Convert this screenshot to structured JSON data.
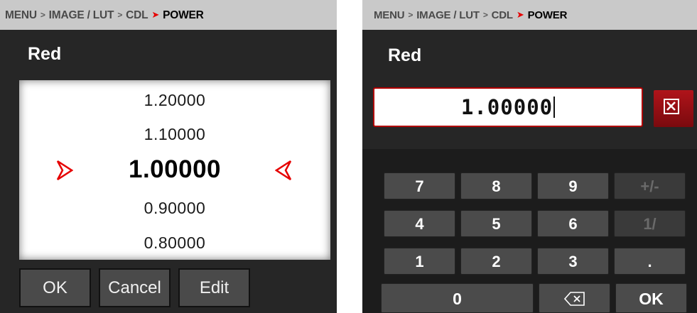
{
  "left_panel": {
    "breadcrumb": {
      "items": [
        "MENU",
        "IMAGE / LUT",
        "CDL"
      ],
      "current": "POWER"
    },
    "title": "Red",
    "picker": {
      "values": [
        "1.20000",
        "1.10000",
        "1.00000",
        "0.90000",
        "0.80000"
      ],
      "selected": "1.00000"
    },
    "buttons": {
      "ok": "OK",
      "cancel": "Cancel",
      "edit": "Edit"
    }
  },
  "right_panel": {
    "breadcrumb": {
      "items": [
        "MENU",
        "IMAGE / LUT",
        "CDL"
      ],
      "current": "POWER"
    },
    "title": "Red",
    "input_value": "1.00000",
    "clear_icon": "close-box-icon",
    "keypad": {
      "rows": [
        [
          "7",
          "8",
          "9",
          "+/-"
        ],
        [
          "4",
          "5",
          "6",
          "1/"
        ],
        [
          "1",
          "2",
          "3",
          "."
        ],
        [
          "0",
          "backspace",
          "OK"
        ]
      ],
      "disabled_keys": [
        "+/-",
        "1/"
      ]
    }
  },
  "colors": {
    "accent_red": "#e60000",
    "panel_bg": "#262626",
    "breadcrumb_bg": "#c9c9c9",
    "button_gray": "#4b4b4b"
  }
}
